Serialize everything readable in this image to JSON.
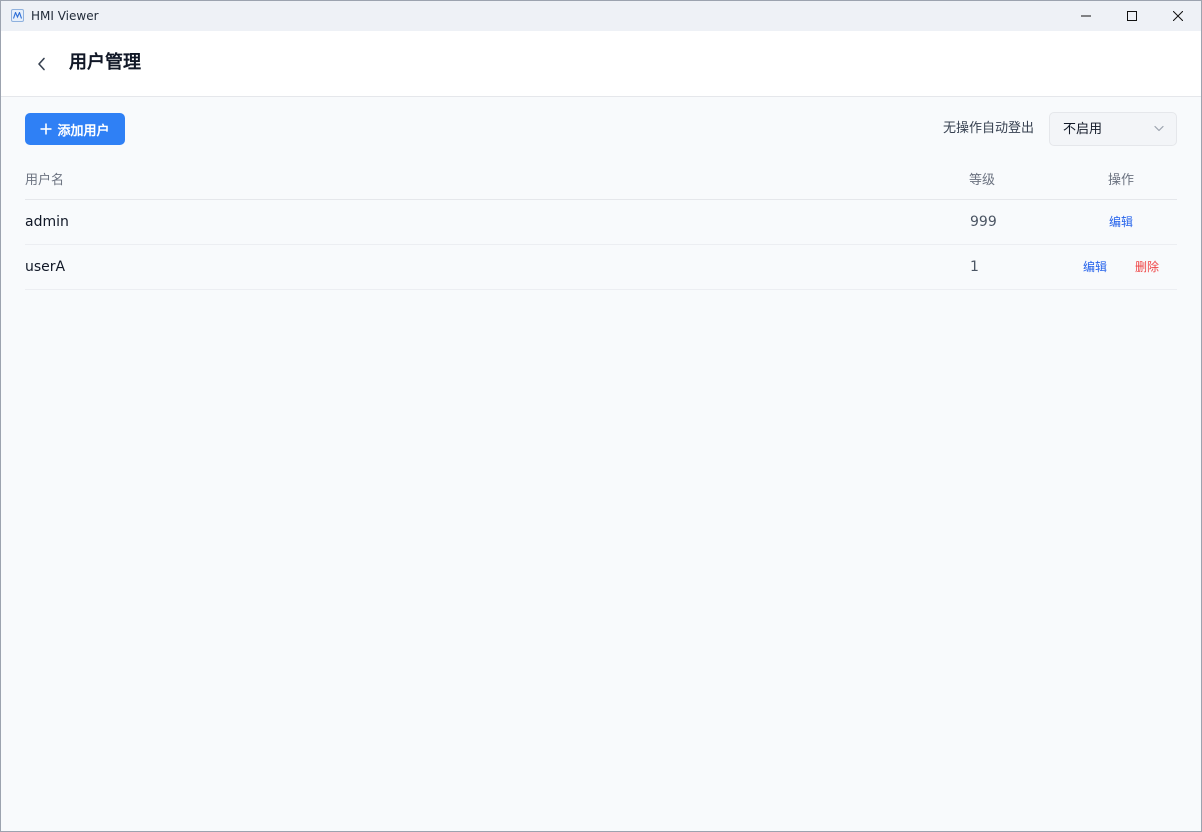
{
  "window": {
    "title": "HMI Viewer"
  },
  "header": {
    "title": "用户管理"
  },
  "toolbar": {
    "add_user_label": "添加用户",
    "auto_logout_label": "无操作自动登出",
    "auto_logout_value": "不启用"
  },
  "table": {
    "columns": {
      "username": "用户名",
      "level": "等级",
      "actions": "操作"
    },
    "rows": [
      {
        "username": "admin",
        "level": "999",
        "edit": "编辑"
      },
      {
        "username": "userA",
        "level": "1",
        "edit": "编辑",
        "delete": "删除"
      }
    ]
  },
  "colors": {
    "accent": "#2f80f5",
    "link": "#2563eb",
    "danger": "#ef4444",
    "background": "#f8fafc"
  }
}
